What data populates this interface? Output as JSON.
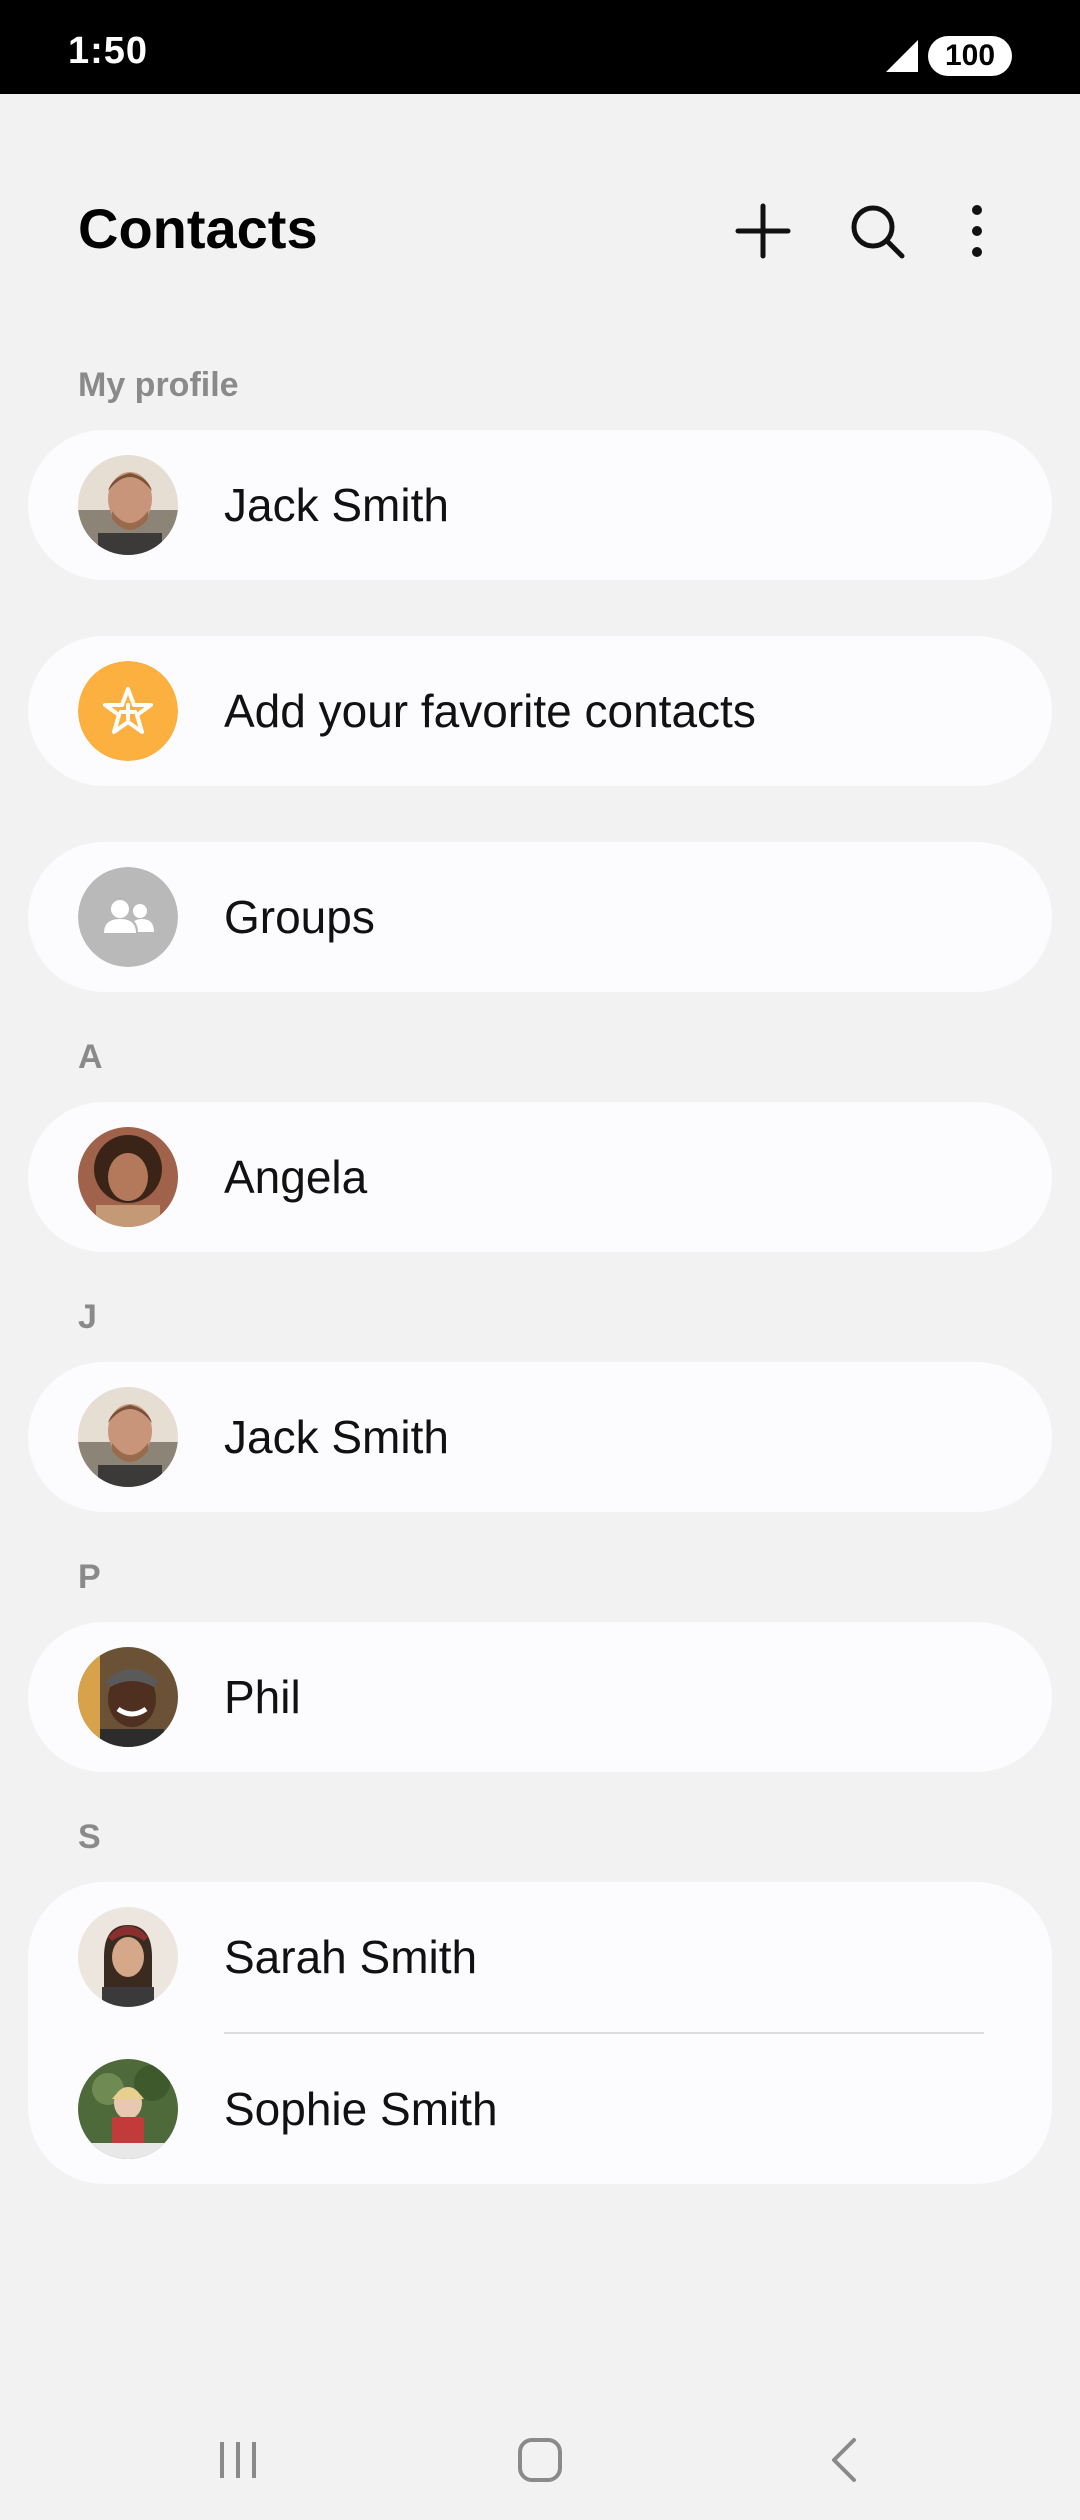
{
  "status": {
    "time": "1:50",
    "battery": "100"
  },
  "header": {
    "title": "Contacts",
    "add_icon": "plus-icon",
    "search_icon": "search-icon",
    "more_icon": "more-vertical-icon"
  },
  "sections": {
    "my_profile": "My profile",
    "a": "A",
    "j": "J",
    "p": "P",
    "s": "S"
  },
  "profile": {
    "name": "Jack Smith"
  },
  "favorites": {
    "label": "Add your favorite contacts",
    "icon": "star-icon",
    "color": "#fbb040"
  },
  "groups": {
    "label": "Groups",
    "icon": "people-icon",
    "color": "#b9b9b9"
  },
  "contacts": {
    "angela": "Angela",
    "jack": "Jack Smith",
    "phil": "Phil",
    "sarah": "Sarah Smith",
    "sophie": "Sophie Smith"
  },
  "nav": {
    "recents": "recents-icon",
    "home": "home-icon",
    "back": "back-icon"
  }
}
